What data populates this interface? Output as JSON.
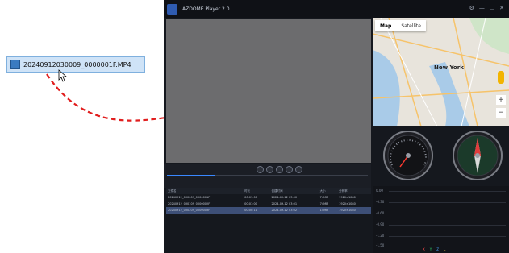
{
  "drag": {
    "file_name": "20240912030009_0000001F.MP4"
  },
  "app": {
    "title": "AZDOME Player 2.0",
    "map": {
      "tab_map": "Map",
      "tab_satellite": "Satellite",
      "city_label": "New York",
      "zoom_in": "+",
      "zoom_out": "−"
    },
    "side_arrow": "›",
    "chart": {
      "yticks": [
        "0.00",
        "-0.30",
        "-0.60",
        "-0.90",
        "-1.20",
        "-1.50"
      ],
      "legend": [
        "X",
        "Y",
        "Z",
        "L"
      ],
      "legend_colors": [
        "#ff4b4b",
        "#2fd36b",
        "#4aa8ff",
        "#ffd84a"
      ]
    },
    "table": {
      "headers": [
        "文件名",
        "时长",
        "创建时间",
        "大小",
        "分辨率"
      ],
      "rows": [
        [
          "20240912_030009_0000001F",
          "00:01:00",
          "2024-09-12 03:00",
          "74MB",
          "1920×1080"
        ],
        [
          "20240912_030109_0000002F",
          "00:01:00",
          "2024-09-12 03:01",
          "74MB",
          "1920×1080"
        ],
        [
          "20240912_030209_0000003F",
          "00:00:11",
          "2024-09-12 03:02",
          "14MB",
          "1920×1080"
        ]
      ],
      "selected_index": 2
    },
    "accent_color": "#3a88ff"
  }
}
